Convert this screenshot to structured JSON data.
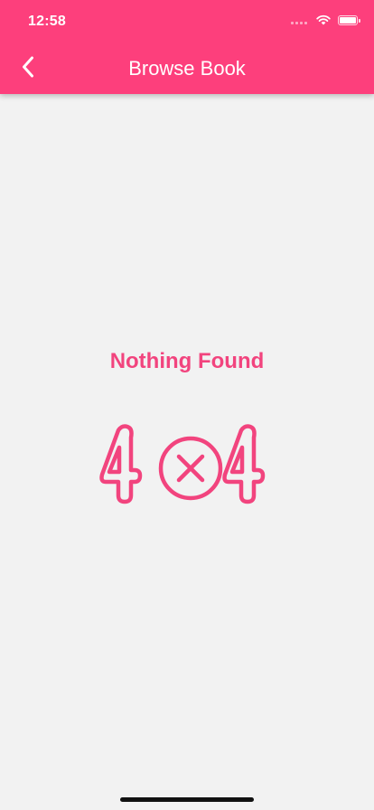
{
  "status_bar": {
    "time": "12:58",
    "signal_icon": "cellular-signal-icon",
    "wifi_icon": "wifi-icon",
    "battery_icon": "battery-icon",
    "battery_level": 1.0
  },
  "nav": {
    "title": "Browse Book",
    "back_icon": "chevron-left-icon"
  },
  "empty_state": {
    "title": "Nothing Found",
    "illustration_icon": "not-found-404-icon"
  },
  "colors": {
    "accent": "#fd3f7c",
    "text_accent": "#f2447e",
    "background": "#f2f2f2"
  }
}
